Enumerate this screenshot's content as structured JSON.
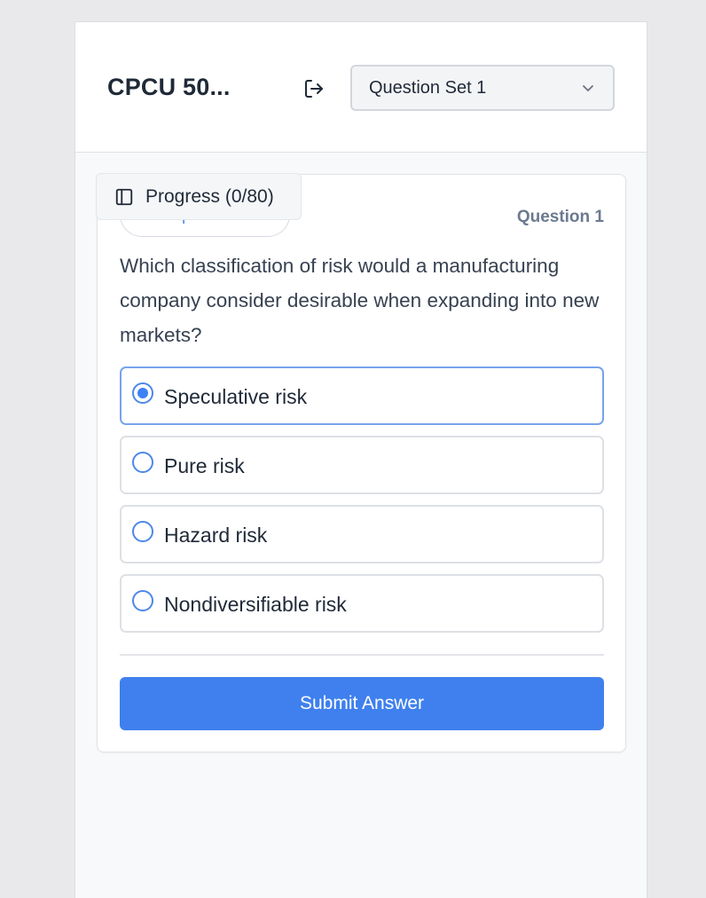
{
  "header": {
    "app_title": "CPCU 50...",
    "logout_icon": "logout-icon",
    "question_set": {
      "selected": "Question Set 1",
      "icon": "chevron-down-icon"
    }
  },
  "progress": {
    "label": "Progress (0/80)",
    "icon": "sidebar-panel-icon"
  },
  "question": {
    "type": "Multiple Choice",
    "number_label": "Question 1",
    "text": "Which classification of risk would a manufacturing company consider desirable when expanding into new markets?",
    "options": [
      {
        "label": "Speculative risk",
        "selected": true
      },
      {
        "label": "Pure risk",
        "selected": false
      },
      {
        "label": "Hazard risk",
        "selected": false
      },
      {
        "label": "Nondiversifiable risk",
        "selected": false
      }
    ],
    "submit_label": "Submit Answer"
  },
  "colors": {
    "accent": "#3f80ee",
    "selected_border": "#77a3ec",
    "pill_text": "#5b8fe8"
  }
}
